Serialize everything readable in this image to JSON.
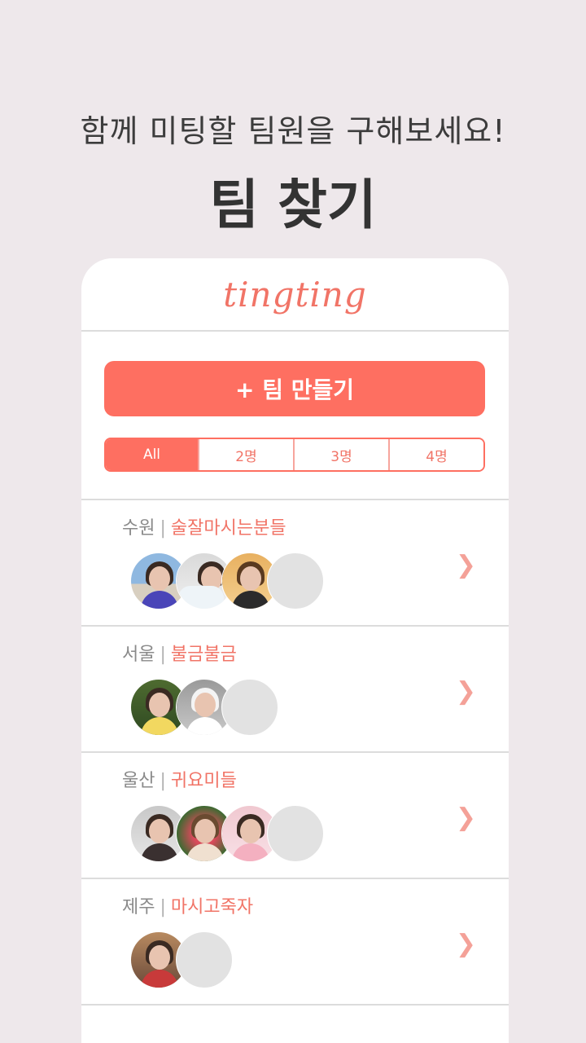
{
  "promo": {
    "subtitle": "함께 미팅할 팀원을 구해보세요!",
    "title": "팀 찾기"
  },
  "app": {
    "logo": "tingting",
    "create_button": "+ 팀 만들기",
    "filters": [
      {
        "label": "All",
        "active": true
      },
      {
        "label": "2명",
        "active": false
      },
      {
        "label": "3명",
        "active": false
      },
      {
        "label": "4명",
        "active": false
      }
    ],
    "teams": [
      {
        "city": "수원",
        "separator": "|",
        "name": "술잘마시는분들",
        "members": 3,
        "capacity": 4
      },
      {
        "city": "서울",
        "separator": "|",
        "name": "불금불금",
        "members": 2,
        "capacity": 3
      },
      {
        "city": "울산",
        "separator": "|",
        "name": "귀요미들",
        "members": 3,
        "capacity": 4
      },
      {
        "city": "제주",
        "separator": "|",
        "name": "마시고죽자",
        "members": 1,
        "capacity": 2
      }
    ],
    "chevron_icon": "chevron-right-icon"
  },
  "colors": {
    "accent": "#fe6f61",
    "accent_text": "#f17467",
    "background": "#eee8eb"
  }
}
